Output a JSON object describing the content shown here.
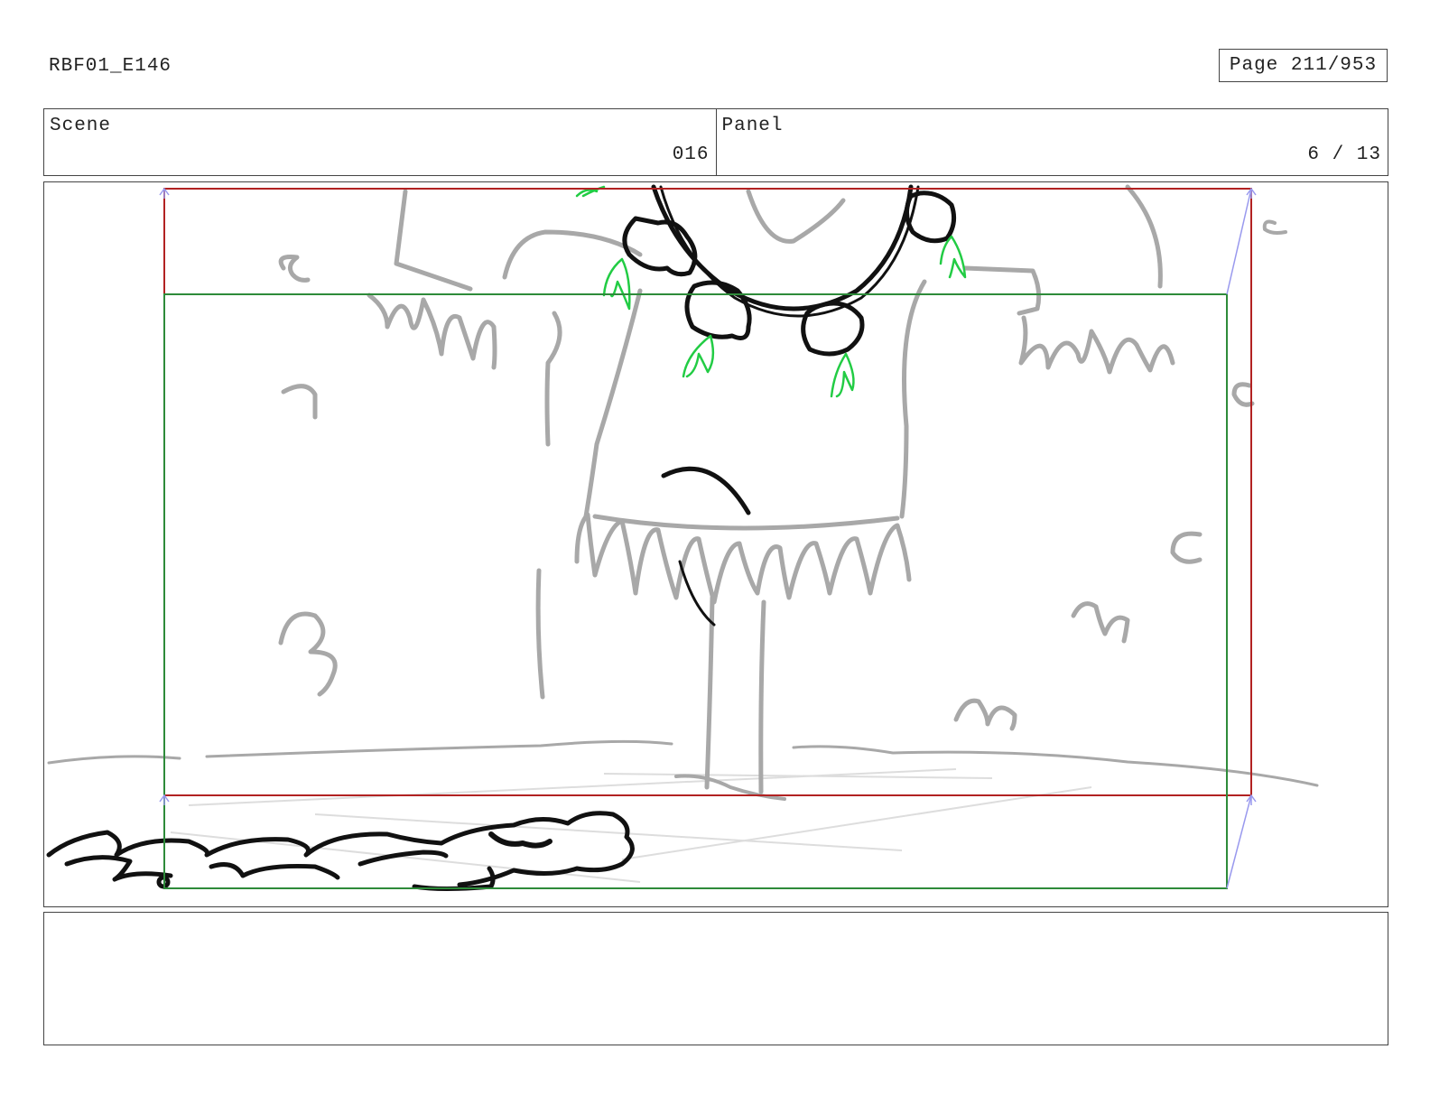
{
  "header": {
    "document_id": "RBF01_E146",
    "page_label": "Page 211/953"
  },
  "info_table": {
    "scene": {
      "label": "Scene",
      "value": "016"
    },
    "panel": {
      "label": "Panel",
      "value": "6 / 13"
    }
  },
  "drawing": {
    "colors": {
      "sketch_gray": "#a8a8a8",
      "ink_black": "#111111",
      "accent_green": "#22cc44",
      "frame_red": "#b22222",
      "frame_green": "#2e8b3a",
      "guide_violet": "#9999ee"
    }
  },
  "notes": {
    "text": ""
  }
}
